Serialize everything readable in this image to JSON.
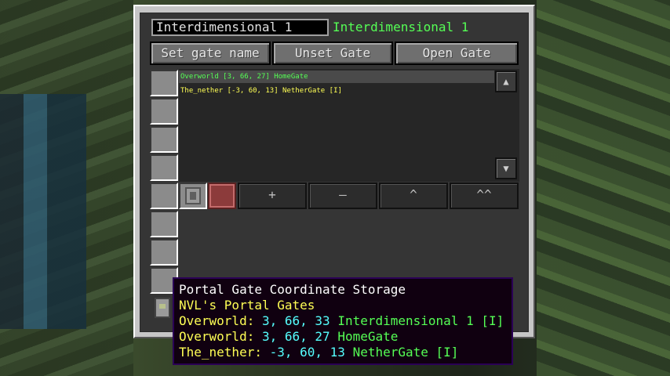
{
  "gate_name": {
    "input_value": "Interdimensional 1",
    "display_name": "Interdimensional 1"
  },
  "buttons": {
    "set_name": "Set gate name",
    "unset": "Unset Gate",
    "open": "Open Gate"
  },
  "gate_list": [
    {
      "text": "Overworld [3, 66, 27] HomeGate",
      "color": "#55ff55",
      "selected": true
    },
    {
      "text": "The_nether [-3, 60, 13] NetherGate [I]",
      "color": "#ffff55",
      "selected": false
    }
  ],
  "scroll": {
    "up": "▲",
    "down": "▼"
  },
  "toolbar": {
    "plus": "+",
    "minus": "–",
    "up": "^",
    "top": "^^"
  },
  "tooltip": {
    "title": "Portal Gate Coordinate Storage",
    "mod": "NVL's Portal Gates",
    "entries": [
      {
        "label": "Overworld:",
        "coords": "3, 66, 33",
        "name": "Interdimensional 1 [I]"
      },
      {
        "label": "Overworld:",
        "coords": "3, 66, 27",
        "name": "HomeGate"
      },
      {
        "label": "The_nether:",
        "coords": "-3, 60, 13",
        "name": "NetherGate [I]"
      }
    ]
  },
  "colors": {
    "gate_name": "#55ff55",
    "mod_name": "#ffff55",
    "dimension": "#ffff55",
    "coords": "#55ffff",
    "entry_name": "#55ff55",
    "title": "#ffffff"
  }
}
